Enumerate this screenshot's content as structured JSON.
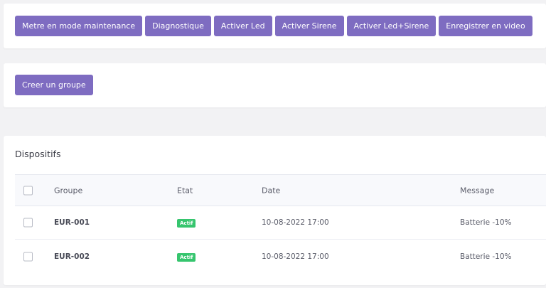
{
  "actions": {
    "buttons": [
      "Metre en mode maintenance",
      "Diagnostique",
      "Activer Led",
      "Activer Sirene",
      "Activer Led+Sirene",
      "Enregistrer en video"
    ]
  },
  "groups": {
    "create_label": "Creer un groupe"
  },
  "devices": {
    "title": "Dispositifs",
    "columns": {
      "groupe": "Groupe",
      "etat": "Etat",
      "date": "Date",
      "message": "Message"
    },
    "rows": [
      {
        "groupe": "EUR-001",
        "etat": "Actif",
        "date": "10-08-2022 17:00",
        "message": "Batterie -10%"
      },
      {
        "groupe": "EUR-002",
        "etat": "Actif",
        "date": "10-08-2022 17:00",
        "message": "Batterie -10%"
      }
    ]
  },
  "colors": {
    "accent": "#7e6cc1",
    "status_active": "#36c56e"
  }
}
